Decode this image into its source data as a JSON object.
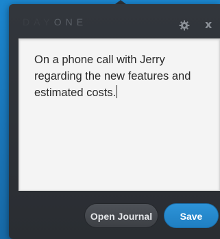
{
  "app": {
    "logo_text_day": "DAY",
    "logo_text_one": "ONE"
  },
  "titlebar": {
    "settings_icon": "gear-icon",
    "close_icon": "close-icon",
    "close_glyph": "x"
  },
  "entry": {
    "text": "On a phone call with Jerry regarding the new features and estimated costs."
  },
  "buttons": {
    "open_journal_label": "Open Journal",
    "save_label": "Save"
  },
  "colors": {
    "desktop_blue": "#1a74b6",
    "panel": "#2f3339",
    "save_accent": "#2189cf"
  }
}
